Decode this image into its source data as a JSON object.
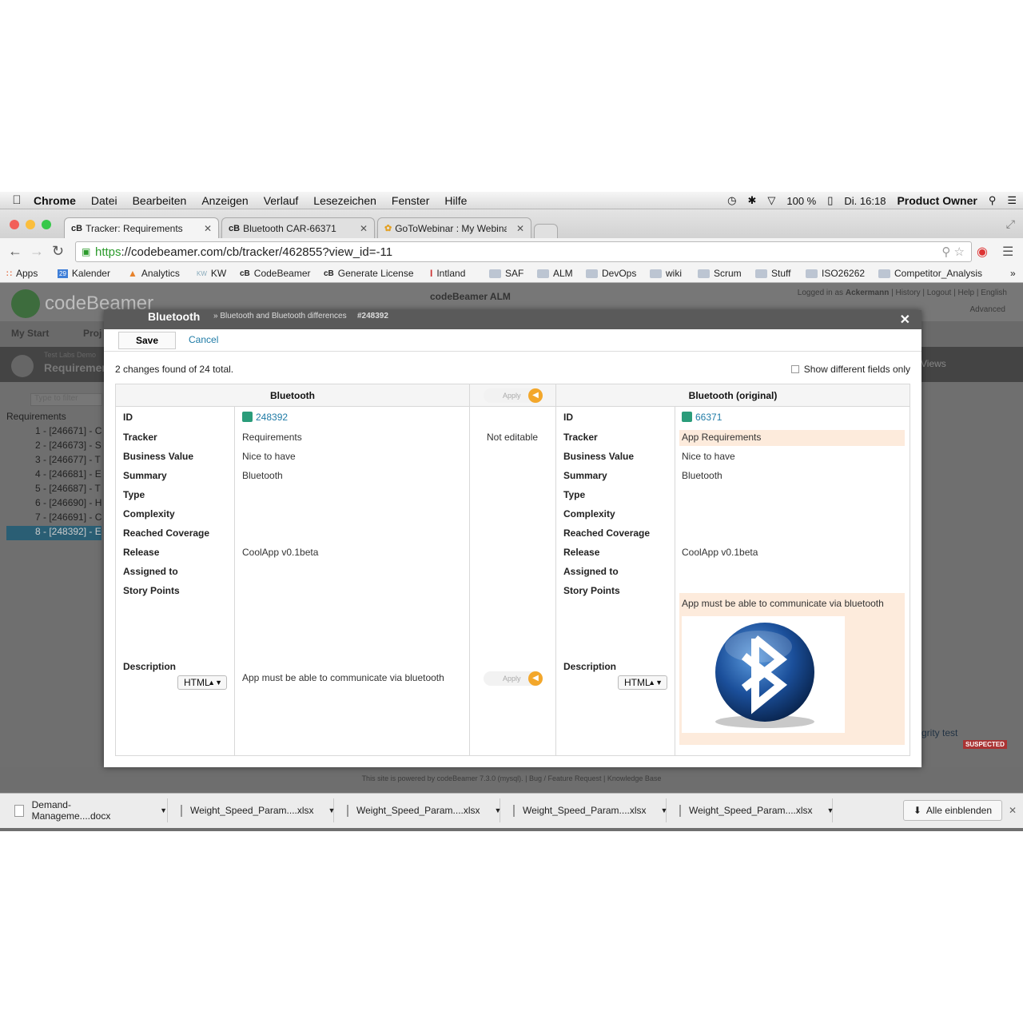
{
  "menubar": {
    "app": "Chrome",
    "items": [
      "Datei",
      "Bearbeiten",
      "Anzeigen",
      "Verlauf",
      "Lesezeichen",
      "Fenster",
      "Hilfe"
    ],
    "battery": "100 %",
    "clock": "Di. 16:18",
    "user": "Product Owner"
  },
  "tabs": [
    {
      "fav": "cB",
      "label": "Tracker: Requirements"
    },
    {
      "fav": "cB",
      "label": "Bluetooth CAR-66371"
    },
    {
      "fav": "✿",
      "label": "GoToWebinar : My Webinar"
    }
  ],
  "address": {
    "scheme": "https",
    "rest": "://codebeamer.com/cb/tracker/462855?view_id=-11"
  },
  "bookmarks": [
    "Apps",
    "Kalender",
    "Analytics",
    "KW",
    "CodeBeamer",
    "Generate License",
    "Intland",
    "SAF",
    "ALM",
    "DevOps",
    "wiki",
    "Scrum",
    "Stuff",
    "ISO26262",
    "Competitor_Analysis"
  ],
  "app": {
    "brand": "codeBeamer",
    "title": "codeBeamer ALM",
    "logged_in_prefix": "Logged in as",
    "user": "Ackermann",
    "links": "| History | Logout | Help | English",
    "advanced": "Advanced",
    "nav": [
      "My Start",
      "Proj"
    ],
    "project": "Test Labs Demo",
    "page": "Requirements",
    "filter_placeholder": "Type to filter",
    "views": "Views",
    "tree_root": "Requirements",
    "tree": [
      "1 - [246671] - C",
      "2 - [246673] - S",
      "3 - [246677] - T",
      "4 - [246681] - E",
      "5 - [246687] - T",
      "6 - [246690] - H",
      "7 - [246691] - C",
      "8 - [248392] - E"
    ],
    "integrity": "grity test",
    "suspected": "SUSPECTED",
    "footer": "This site is powered by codeBeamer 7.3.0 (mysql). | Bug / Feature Request | Knowledge Base"
  },
  "modal": {
    "title": "Bluetooth",
    "crumb": "» Bluetooth and Bluetooth differences",
    "item_id": "#248392",
    "save": "Save",
    "cancel": "Cancel",
    "summary": "2 changes found of 24 total.",
    "show_diff": "Show different fields only",
    "left_header": "Bluetooth",
    "right_header": "Bluetooth (original)",
    "apply": "Apply",
    "not_editable": "Not editable",
    "description_label": "Description",
    "format": "HTML",
    "labels": [
      "ID",
      "Tracker",
      "Business Value",
      "Summary",
      "Type",
      "Complexity",
      "Reached Coverage",
      "Release",
      "Assigned to",
      "Story Points"
    ],
    "left_values": [
      "248392",
      "Requirements",
      "Nice to have",
      "Bluetooth",
      "",
      "",
      "",
      "CoolApp v0.1beta",
      "",
      ""
    ],
    "right_values": [
      "66371",
      "App Requirements",
      "Nice to have",
      "Bluetooth",
      "",
      "",
      "",
      "CoolApp v0.1beta",
      "",
      ""
    ],
    "left_description": "App must be able to communicate via bluetooth",
    "right_description": "App must be able to communicate via bluetooth"
  },
  "downloads": {
    "files": [
      "Demand-Manageme....docx",
      "Weight_Speed_Param....xlsx",
      "Weight_Speed_Param....xlsx",
      "Weight_Speed_Param....xlsx",
      "Weight_Speed_Param....xlsx"
    ],
    "show_all": "Alle einblenden"
  },
  "colors": {
    "accent": "#1f7ba6",
    "apply": "#f3a72b",
    "highlight": "#fdebdc",
    "modal_title": "#5a5a5a"
  }
}
